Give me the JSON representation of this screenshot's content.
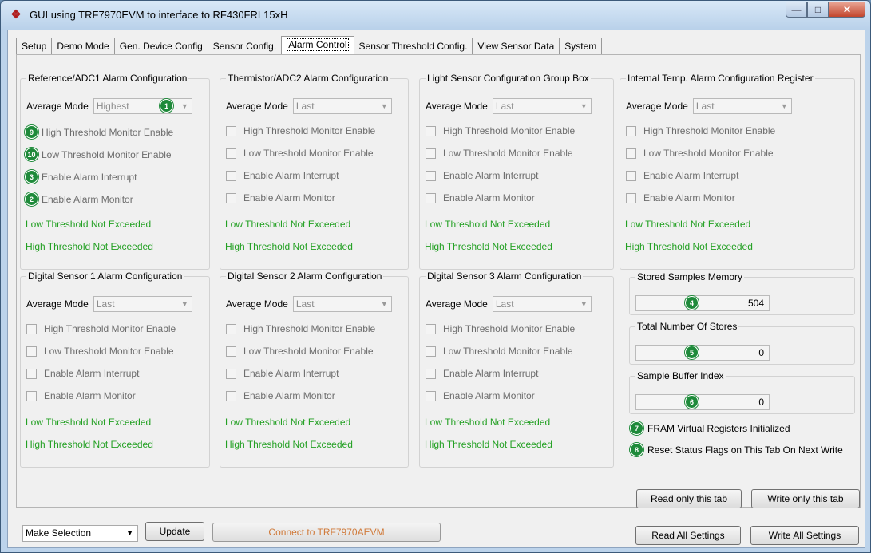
{
  "window": {
    "title": "GUI using TRF7970EVM to interface to RF430FRL15xH",
    "icon": "ti-logo-icon"
  },
  "tabs": [
    "Setup",
    "Demo Mode",
    "Gen. Device Config",
    "Sensor Config.",
    "Alarm Control",
    "Sensor Threshold Config.",
    "View Sensor Data",
    "System"
  ],
  "active_tab": "Alarm Control",
  "groups": [
    {
      "title": "Reference/ADC1 Alarm Configuration",
      "avg_label": "Average Mode",
      "avg_value": "Highest",
      "checks": [
        "High Threshold Monitor Enable",
        "Low Threshold Monitor Enable",
        "Enable Alarm Interrupt",
        "Enable Alarm Monitor"
      ],
      "low_status": "Low Threshold Not Exceeded",
      "high_status": "High Threshold Not Exceeded"
    },
    {
      "title": "Thermistor/ADC2 Alarm Configuration",
      "avg_label": "Average Mode",
      "avg_value": "Last",
      "checks": [
        "High Threshold Monitor Enable",
        "Low Threshold Monitor Enable",
        "Enable Alarm Interrupt",
        "Enable Alarm Monitor"
      ],
      "low_status": "Low Threshold Not Exceeded",
      "high_status": "High Threshold Not Exceeded"
    },
    {
      "title": "Light Sensor Configuration Group Box",
      "avg_label": "Average Mode",
      "avg_value": "Last",
      "checks": [
        "High Threshold Monitor Enable",
        "Low Threshold Monitor Enable",
        "Enable Alarm Interrupt",
        "Enable Alarm Monitor"
      ],
      "low_status": "Low Threshold Not Exceeded",
      "high_status": "High Threshold Not Exceeded"
    },
    {
      "title": "Internal Temp. Alarm Configuration Register",
      "avg_label": "Average Mode",
      "avg_value": "Last",
      "checks": [
        "High Threshold Monitor Enable",
        "Low Threshold Monitor Enable",
        "Enable Alarm Interrupt",
        "Enable Alarm Monitor"
      ],
      "low_status": "Low Threshold Not Exceeded",
      "high_status": "High Threshold Not Exceeded"
    },
    {
      "title": "Digital Sensor 1 Alarm Configuration",
      "avg_label": "Average Mode",
      "avg_value": "Last",
      "checks": [
        "High Threshold Monitor Enable",
        "Low Threshold Monitor Enable",
        "Enable Alarm Interrupt",
        "Enable Alarm Monitor"
      ],
      "low_status": "Low Threshold Not Exceeded",
      "high_status": "High Threshold Not Exceeded"
    },
    {
      "title": "Digital Sensor 2 Alarm Configuration",
      "avg_label": "Average Mode",
      "avg_value": "Last",
      "checks": [
        "High Threshold Monitor Enable",
        "Low Threshold Monitor Enable",
        "Enable Alarm Interrupt",
        "Enable Alarm Monitor"
      ],
      "low_status": "Low Threshold Not Exceeded",
      "high_status": "High Threshold Not Exceeded"
    },
    {
      "title": "Digital Sensor 3 Alarm Configuration",
      "avg_label": "Average Mode",
      "avg_value": "Last",
      "checks": [
        "High Threshold Monitor Enable",
        "Low Threshold Monitor Enable",
        "Enable Alarm Interrupt",
        "Enable Alarm Monitor"
      ],
      "low_status": "Low Threshold Not Exceeded",
      "high_status": "High Threshold Not Exceeded"
    }
  ],
  "badges": {
    "avg": "1",
    "high": "9",
    "low": "10",
    "interrupt": "3",
    "monitor": "2",
    "stored": "4",
    "total": "5",
    "buffer": "6",
    "fram": "7",
    "reset": "8"
  },
  "stored_samples": {
    "title": "Stored Samples Memory",
    "value": "504"
  },
  "total_stores": {
    "title": "Total Number Of Stores",
    "value": "0"
  },
  "sample_buffer": {
    "title": "Sample Buffer Index",
    "value": "0"
  },
  "indicators": {
    "fram": "FRAM Virtual Registers Initialized",
    "reset": "Reset Status Flags on This Tab On Next Write"
  },
  "buttons": {
    "read_tab": "Read only this tab",
    "write_tab": "Write only this tab",
    "read_all": "Read All Settings",
    "write_all": "Write All Settings",
    "update": "Update",
    "connect": "Connect to TRF7970AEVM"
  },
  "selection": {
    "value": "Make Selection"
  },
  "colors": {
    "status_green": "#23a023",
    "badge_green": "#1e8a3a",
    "connect_text": "#d07a3a"
  }
}
